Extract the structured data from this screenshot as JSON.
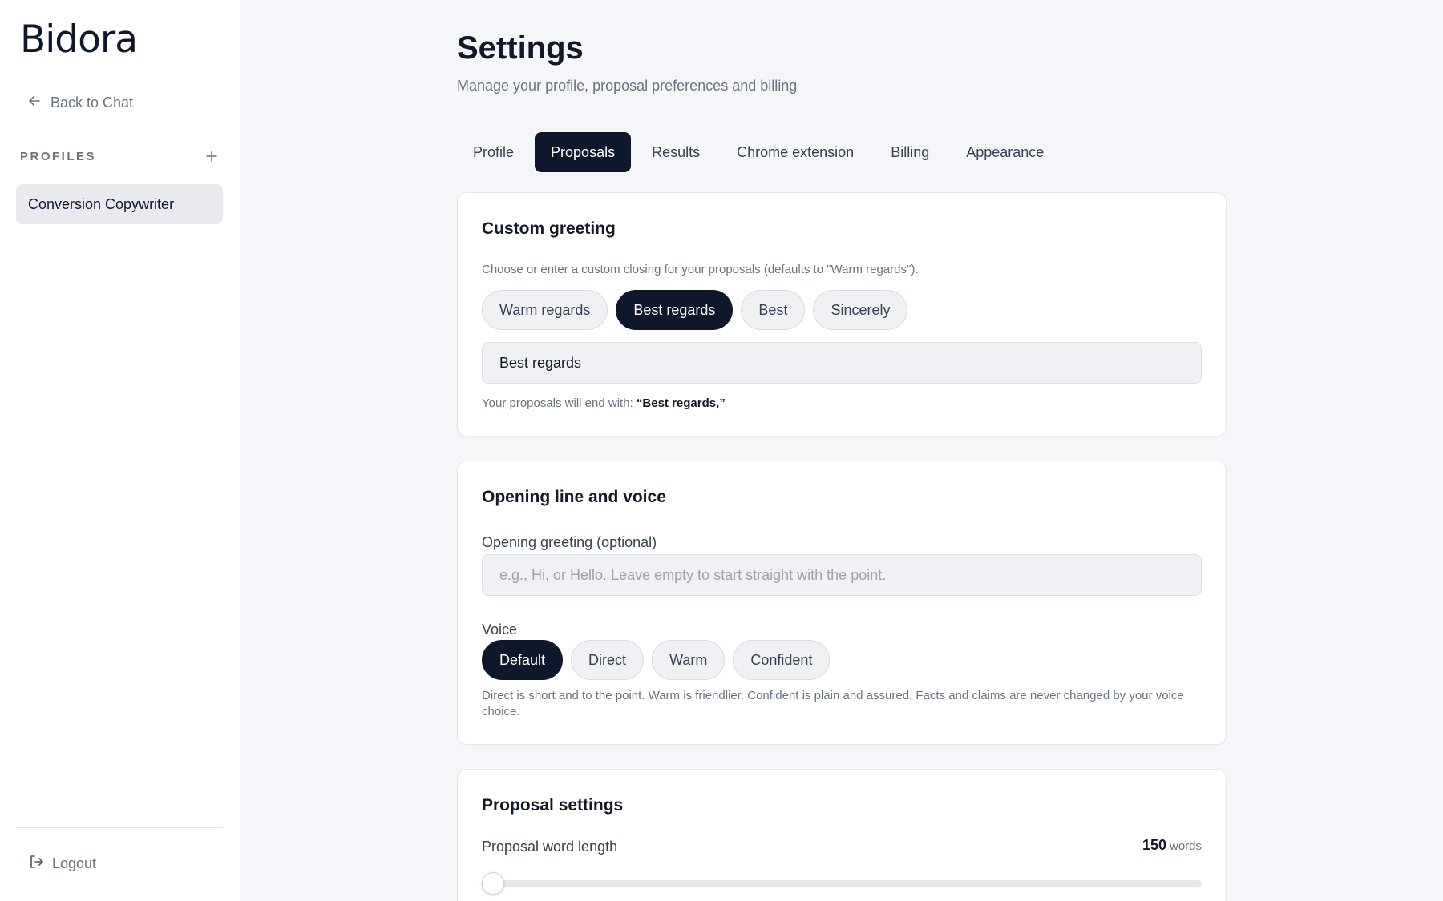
{
  "sidebar": {
    "brand": "Bidora",
    "back_label": "Back to Chat",
    "profiles_label": "PROFILES",
    "profiles": [
      "Conversion Copywriter"
    ],
    "logout_label": "Logout"
  },
  "header": {
    "title": "Settings",
    "subtitle": "Manage your profile, proposal preferences and billing"
  },
  "tabs": [
    {
      "label": "Profile",
      "active": false
    },
    {
      "label": "Proposals",
      "active": true
    },
    {
      "label": "Results",
      "active": false
    },
    {
      "label": "Chrome extension",
      "active": false
    },
    {
      "label": "Billing",
      "active": false
    },
    {
      "label": "Appearance",
      "active": false
    }
  ],
  "custom_greeting": {
    "title": "Custom greeting",
    "hint": "Choose or enter a custom closing for your proposals (defaults to \"Warm regards\").",
    "options": [
      "Warm regards",
      "Best regards",
      "Best",
      "Sincerely"
    ],
    "selected": "Best regards",
    "input_value": "Best regards",
    "ending_prefix": "Your proposals will end with:",
    "ending_value": "“Best regards,”"
  },
  "opening": {
    "title": "Opening line and voice",
    "greeting_label": "Opening greeting (optional)",
    "greeting_placeholder": "e.g., Hi, or Hello. Leave empty to start straight with the point.",
    "greeting_value": "",
    "voice_label": "Voice",
    "voice_options": [
      "Default",
      "Direct",
      "Warm",
      "Confident"
    ],
    "voice_selected": "Default",
    "voice_hint": "Direct is short and to the point. Warm is friendlier. Confident is plain and assured. Facts and claims are never changed by your voice choice."
  },
  "proposal_settings": {
    "title": "Proposal settings",
    "word_length_label": "Proposal word length",
    "word_length_value": "150",
    "word_length_unit": "words",
    "slider_fraction": 0
  },
  "colors": {
    "accent": "#0f172a",
    "background": "#f5f6f9"
  }
}
